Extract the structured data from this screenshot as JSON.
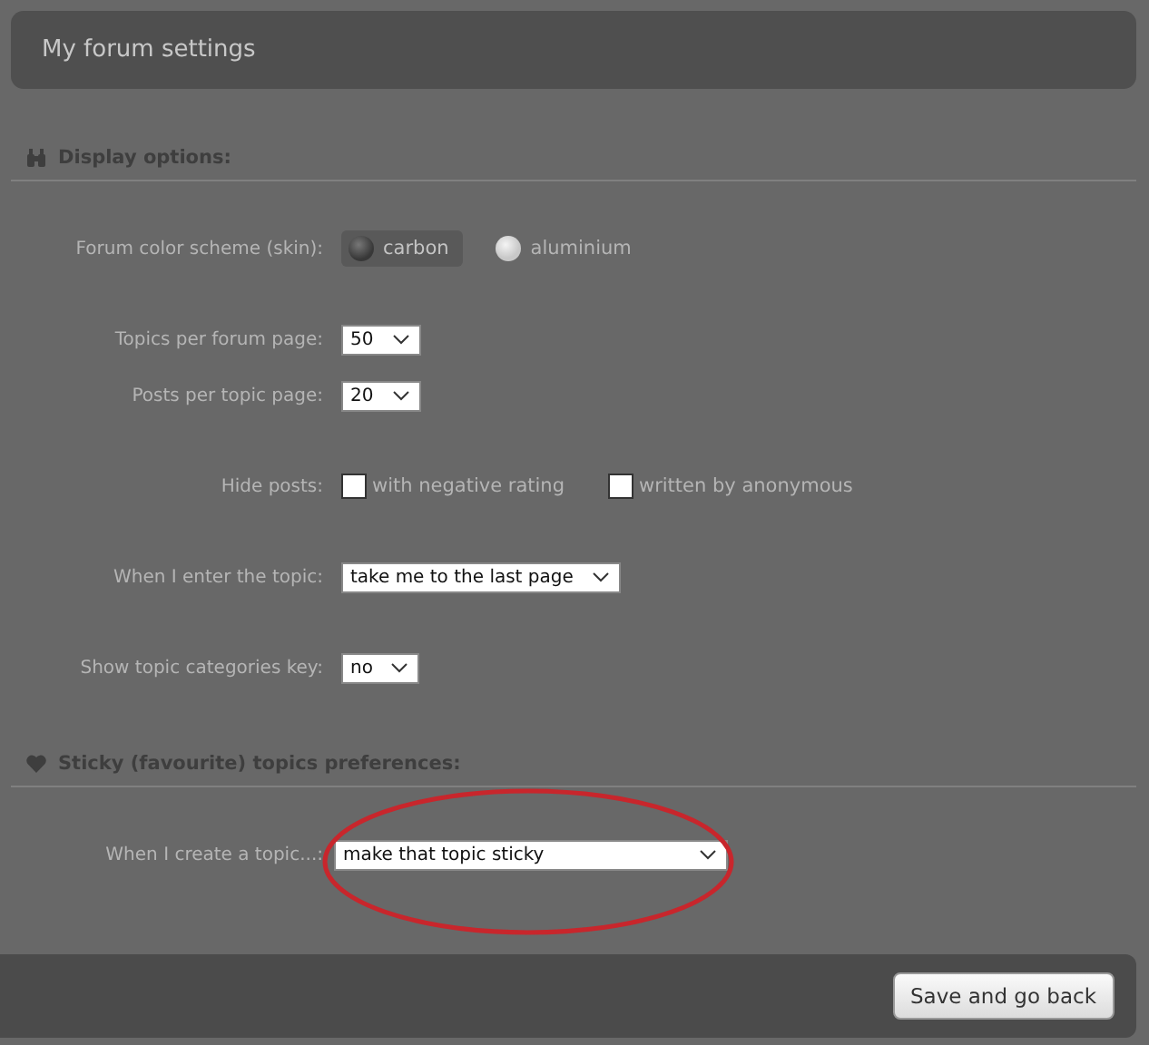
{
  "header": {
    "title": "My forum settings"
  },
  "sections": [
    {
      "title": "Display options:",
      "groups": [
        [
          {
            "kind": "radio",
            "label": "Forum color scheme (skin):",
            "options": [
              {
                "text": "carbon",
                "selected": true
              },
              {
                "text": "aluminium",
                "selected": false
              }
            ]
          }
        ],
        [
          {
            "kind": "select",
            "label": "Topics per forum page:",
            "value": "50",
            "highlighted": false
          },
          {
            "kind": "select",
            "label": "Posts per topic page:",
            "value": "20",
            "highlighted": false
          }
        ],
        [
          {
            "kind": "checkbox",
            "label": "Hide posts:",
            "options": [
              {
                "text": "with negative rating",
                "checked": false
              },
              {
                "text": "written by anonymous",
                "checked": false
              }
            ]
          }
        ],
        [
          {
            "kind": "select",
            "label": "When I enter the topic:",
            "value": "take me to the last page",
            "highlighted": false
          }
        ],
        [
          {
            "kind": "select",
            "label": "Show topic categories key:",
            "value": "no",
            "highlighted": false
          }
        ]
      ]
    },
    {
      "title": "Sticky (favourite) topics preferences:",
      "groups": [
        [
          {
            "kind": "select",
            "label": "When I create a topic...:",
            "value": "make that topic sticky",
            "highlighted": true
          }
        ]
      ]
    }
  ],
  "footer": {
    "button": "Save and go back"
  }
}
